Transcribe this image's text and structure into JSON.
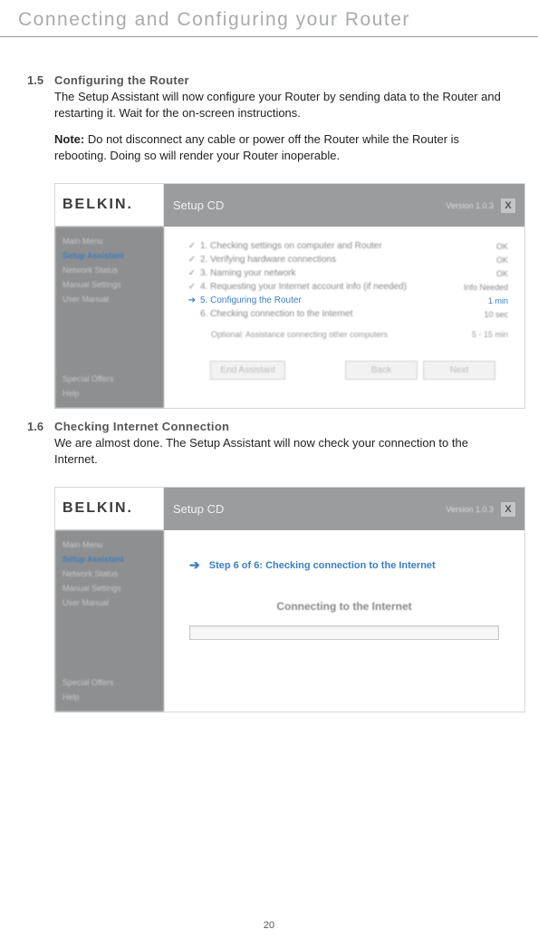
{
  "page": {
    "header": "Connecting and Configuring your Router",
    "number": "20"
  },
  "section15": {
    "num": "1.5",
    "title": "Configuring the Router",
    "body": "The Setup Assistant will now configure your Router by sending data to the Router and restarting it. Wait for the on-screen instructions.",
    "note_label": "Note:",
    "note_body": "Do not disconnect any cable or power off the Router while the Router is rebooting. Doing so will render your Router inoperable."
  },
  "section16": {
    "num": "1.6",
    "title": "Checking Internet Connection",
    "body": "We are almost done. The Setup Assistant will now check your connection to the Internet."
  },
  "screenshot1": {
    "logo": "BELKIN.",
    "title": "Setup CD",
    "version": "Version 1.0.3",
    "close": "X",
    "sidebar_top": [
      "Main Menu",
      "Setup Assistant",
      "Network Status",
      "Manual Settings",
      "User Manual"
    ],
    "sidebar_bottom": [
      "Special Offers",
      "Help"
    ],
    "steps": [
      {
        "ico": "✓",
        "label": "1. Checking settings on computer and Router",
        "status": "OK"
      },
      {
        "ico": "✓",
        "label": "2. Verifying hardware connections",
        "status": "OK"
      },
      {
        "ico": "✓",
        "label": "3. Naming your network",
        "status": "OK"
      },
      {
        "ico": "✓",
        "label": "4. Requesting your Internet account info (if needed)",
        "status": "Info Needed"
      },
      {
        "ico": "➔",
        "label": "5. Configuring the Router",
        "status": "1 min"
      },
      {
        "ico": "",
        "label": "6. Checking connection to the Internet",
        "status": "10 sec"
      }
    ],
    "optional_label": "Optional: Assistance connecting other computers",
    "optional_status": "5 - 15 min",
    "buttons": {
      "end": "End Assistant",
      "back": "Back",
      "next": "Next"
    }
  },
  "screenshot2": {
    "logo": "BELKIN.",
    "title": "Setup CD",
    "version": "Version 1.0.3",
    "close": "X",
    "sidebar_top": [
      "Main Menu",
      "Setup Assistant",
      "Network Status",
      "Manual Settings",
      "User Manual"
    ],
    "sidebar_bottom": [
      "Special Offers",
      "Help"
    ],
    "step_line": "Step 6 of 6: Checking connection to the Internet",
    "connecting": "Connecting to the Internet"
  }
}
